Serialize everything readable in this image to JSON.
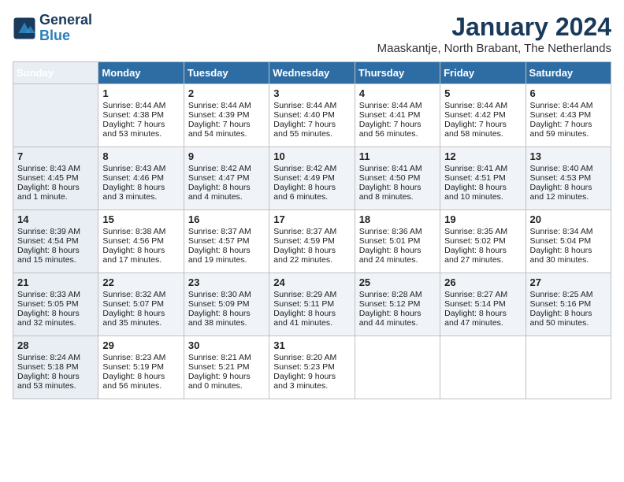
{
  "header": {
    "logo_line1": "General",
    "logo_line2": "Blue",
    "month_title": "January 2024",
    "location": "Maaskantje, North Brabant, The Netherlands"
  },
  "days_of_week": [
    "Sunday",
    "Monday",
    "Tuesday",
    "Wednesday",
    "Thursday",
    "Friday",
    "Saturday"
  ],
  "weeks": [
    [
      {
        "day": "",
        "sunrise": "",
        "sunset": "",
        "daylight": ""
      },
      {
        "day": "1",
        "sunrise": "Sunrise: 8:44 AM",
        "sunset": "Sunset: 4:38 PM",
        "daylight": "Daylight: 7 hours and 53 minutes."
      },
      {
        "day": "2",
        "sunrise": "Sunrise: 8:44 AM",
        "sunset": "Sunset: 4:39 PM",
        "daylight": "Daylight: 7 hours and 54 minutes."
      },
      {
        "day": "3",
        "sunrise": "Sunrise: 8:44 AM",
        "sunset": "Sunset: 4:40 PM",
        "daylight": "Daylight: 7 hours and 55 minutes."
      },
      {
        "day": "4",
        "sunrise": "Sunrise: 8:44 AM",
        "sunset": "Sunset: 4:41 PM",
        "daylight": "Daylight: 7 hours and 56 minutes."
      },
      {
        "day": "5",
        "sunrise": "Sunrise: 8:44 AM",
        "sunset": "Sunset: 4:42 PM",
        "daylight": "Daylight: 7 hours and 58 minutes."
      },
      {
        "day": "6",
        "sunrise": "Sunrise: 8:44 AM",
        "sunset": "Sunset: 4:43 PM",
        "daylight": "Daylight: 7 hours and 59 minutes."
      }
    ],
    [
      {
        "day": "7",
        "sunrise": "Sunrise: 8:43 AM",
        "sunset": "Sunset: 4:45 PM",
        "daylight": "Daylight: 8 hours and 1 minute."
      },
      {
        "day": "8",
        "sunrise": "Sunrise: 8:43 AM",
        "sunset": "Sunset: 4:46 PM",
        "daylight": "Daylight: 8 hours and 3 minutes."
      },
      {
        "day": "9",
        "sunrise": "Sunrise: 8:42 AM",
        "sunset": "Sunset: 4:47 PM",
        "daylight": "Daylight: 8 hours and 4 minutes."
      },
      {
        "day": "10",
        "sunrise": "Sunrise: 8:42 AM",
        "sunset": "Sunset: 4:49 PM",
        "daylight": "Daylight: 8 hours and 6 minutes."
      },
      {
        "day": "11",
        "sunrise": "Sunrise: 8:41 AM",
        "sunset": "Sunset: 4:50 PM",
        "daylight": "Daylight: 8 hours and 8 minutes."
      },
      {
        "day": "12",
        "sunrise": "Sunrise: 8:41 AM",
        "sunset": "Sunset: 4:51 PM",
        "daylight": "Daylight: 8 hours and 10 minutes."
      },
      {
        "day": "13",
        "sunrise": "Sunrise: 8:40 AM",
        "sunset": "Sunset: 4:53 PM",
        "daylight": "Daylight: 8 hours and 12 minutes."
      }
    ],
    [
      {
        "day": "14",
        "sunrise": "Sunrise: 8:39 AM",
        "sunset": "Sunset: 4:54 PM",
        "daylight": "Daylight: 8 hours and 15 minutes."
      },
      {
        "day": "15",
        "sunrise": "Sunrise: 8:38 AM",
        "sunset": "Sunset: 4:56 PM",
        "daylight": "Daylight: 8 hours and 17 minutes."
      },
      {
        "day": "16",
        "sunrise": "Sunrise: 8:37 AM",
        "sunset": "Sunset: 4:57 PM",
        "daylight": "Daylight: 8 hours and 19 minutes."
      },
      {
        "day": "17",
        "sunrise": "Sunrise: 8:37 AM",
        "sunset": "Sunset: 4:59 PM",
        "daylight": "Daylight: 8 hours and 22 minutes."
      },
      {
        "day": "18",
        "sunrise": "Sunrise: 8:36 AM",
        "sunset": "Sunset: 5:01 PM",
        "daylight": "Daylight: 8 hours and 24 minutes."
      },
      {
        "day": "19",
        "sunrise": "Sunrise: 8:35 AM",
        "sunset": "Sunset: 5:02 PM",
        "daylight": "Daylight: 8 hours and 27 minutes."
      },
      {
        "day": "20",
        "sunrise": "Sunrise: 8:34 AM",
        "sunset": "Sunset: 5:04 PM",
        "daylight": "Daylight: 8 hours and 30 minutes."
      }
    ],
    [
      {
        "day": "21",
        "sunrise": "Sunrise: 8:33 AM",
        "sunset": "Sunset: 5:05 PM",
        "daylight": "Daylight: 8 hours and 32 minutes."
      },
      {
        "day": "22",
        "sunrise": "Sunrise: 8:32 AM",
        "sunset": "Sunset: 5:07 PM",
        "daylight": "Daylight: 8 hours and 35 minutes."
      },
      {
        "day": "23",
        "sunrise": "Sunrise: 8:30 AM",
        "sunset": "Sunset: 5:09 PM",
        "daylight": "Daylight: 8 hours and 38 minutes."
      },
      {
        "day": "24",
        "sunrise": "Sunrise: 8:29 AM",
        "sunset": "Sunset: 5:11 PM",
        "daylight": "Daylight: 8 hours and 41 minutes."
      },
      {
        "day": "25",
        "sunrise": "Sunrise: 8:28 AM",
        "sunset": "Sunset: 5:12 PM",
        "daylight": "Daylight: 8 hours and 44 minutes."
      },
      {
        "day": "26",
        "sunrise": "Sunrise: 8:27 AM",
        "sunset": "Sunset: 5:14 PM",
        "daylight": "Daylight: 8 hours and 47 minutes."
      },
      {
        "day": "27",
        "sunrise": "Sunrise: 8:25 AM",
        "sunset": "Sunset: 5:16 PM",
        "daylight": "Daylight: 8 hours and 50 minutes."
      }
    ],
    [
      {
        "day": "28",
        "sunrise": "Sunrise: 8:24 AM",
        "sunset": "Sunset: 5:18 PM",
        "daylight": "Daylight: 8 hours and 53 minutes."
      },
      {
        "day": "29",
        "sunrise": "Sunrise: 8:23 AM",
        "sunset": "Sunset: 5:19 PM",
        "daylight": "Daylight: 8 hours and 56 minutes."
      },
      {
        "day": "30",
        "sunrise": "Sunrise: 8:21 AM",
        "sunset": "Sunset: 5:21 PM",
        "daylight": "Daylight: 9 hours and 0 minutes."
      },
      {
        "day": "31",
        "sunrise": "Sunrise: 8:20 AM",
        "sunset": "Sunset: 5:23 PM",
        "daylight": "Daylight: 9 hours and 3 minutes."
      },
      {
        "day": "",
        "sunrise": "",
        "sunset": "",
        "daylight": ""
      },
      {
        "day": "",
        "sunrise": "",
        "sunset": "",
        "daylight": ""
      },
      {
        "day": "",
        "sunrise": "",
        "sunset": "",
        "daylight": ""
      }
    ]
  ]
}
